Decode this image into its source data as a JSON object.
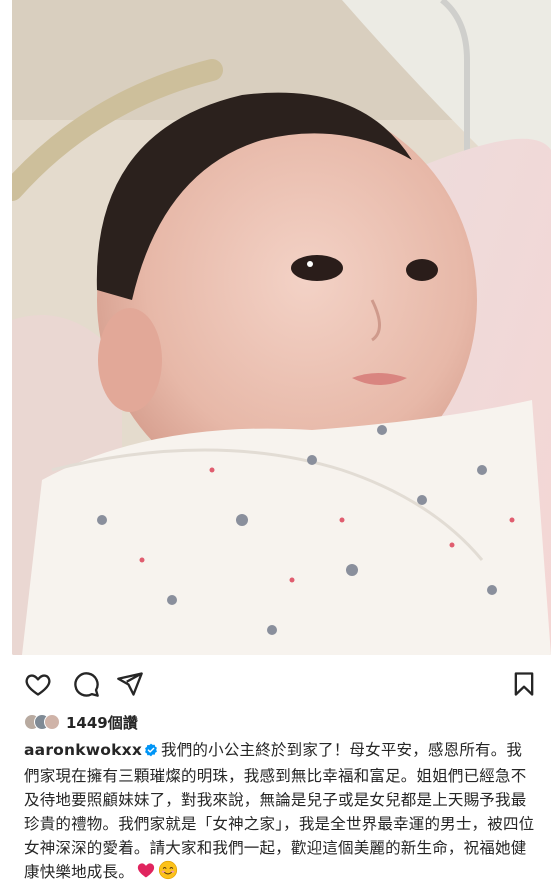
{
  "post": {
    "image_alt_icon": "newborn-photo",
    "likes": {
      "count_label": "1449個讚"
    },
    "caption": {
      "username": "aaronkwokxx",
      "verified_icon": "verified-badge-icon",
      "text": "我們的小公主終於到家了！母女平安，感恩所有。我們家現在擁有三顆璀燦的明珠，我感到無比幸福和富足。姐姐們已經急不及待地要照顧妹妹了，對我來說，無論是兒子或是女兒都是上天賜予我最珍貴的禮物。我們家就是「女神之家」，我是全世界最幸運的男士，被四位女神深深的愛着。請大家和我們一起，歡迎這個美麗的新生命，祝福她健康快樂地成長。",
      "emojis": [
        "heart-emoji",
        "smiling-face-emoji"
      ]
    },
    "actions": [
      "like-icon",
      "comment-icon",
      "share-icon",
      "save-icon"
    ],
    "colors": {
      "text": "#262626",
      "verified": "#0095f6",
      "heart": "#e0245e"
    }
  }
}
